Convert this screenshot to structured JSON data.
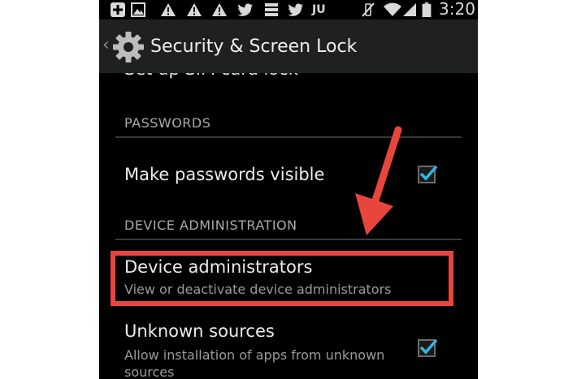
{
  "status_bar": {
    "notification_icons": [
      "plus-icon",
      "image-icon",
      "warning-icon",
      "warning-icon",
      "warning-icon",
      "twitter-icon",
      "list-icon",
      "twitter-icon"
    ],
    "badge_text": "JU",
    "time": "3:20"
  },
  "action_bar": {
    "title": "Security & Screen Lock",
    "back_glyph": "‹"
  },
  "settings": {
    "cut_item_label": "Set up SIM card lock",
    "passwords_header": "PASSWORDS",
    "make_passwords_visible": {
      "title": "Make passwords visible",
      "checked": true
    },
    "device_admin_header": "DEVICE ADMINISTRATION",
    "device_administrators": {
      "title": "Device administrators",
      "summary": "View or deactivate device administrators"
    },
    "unknown_sources": {
      "title": "Unknown sources",
      "summary": "Allow installation of apps from unknown sources",
      "checked": true
    }
  },
  "annotation": {
    "highlight_color": "#e8453c",
    "arrow_color": "#e8453c"
  }
}
